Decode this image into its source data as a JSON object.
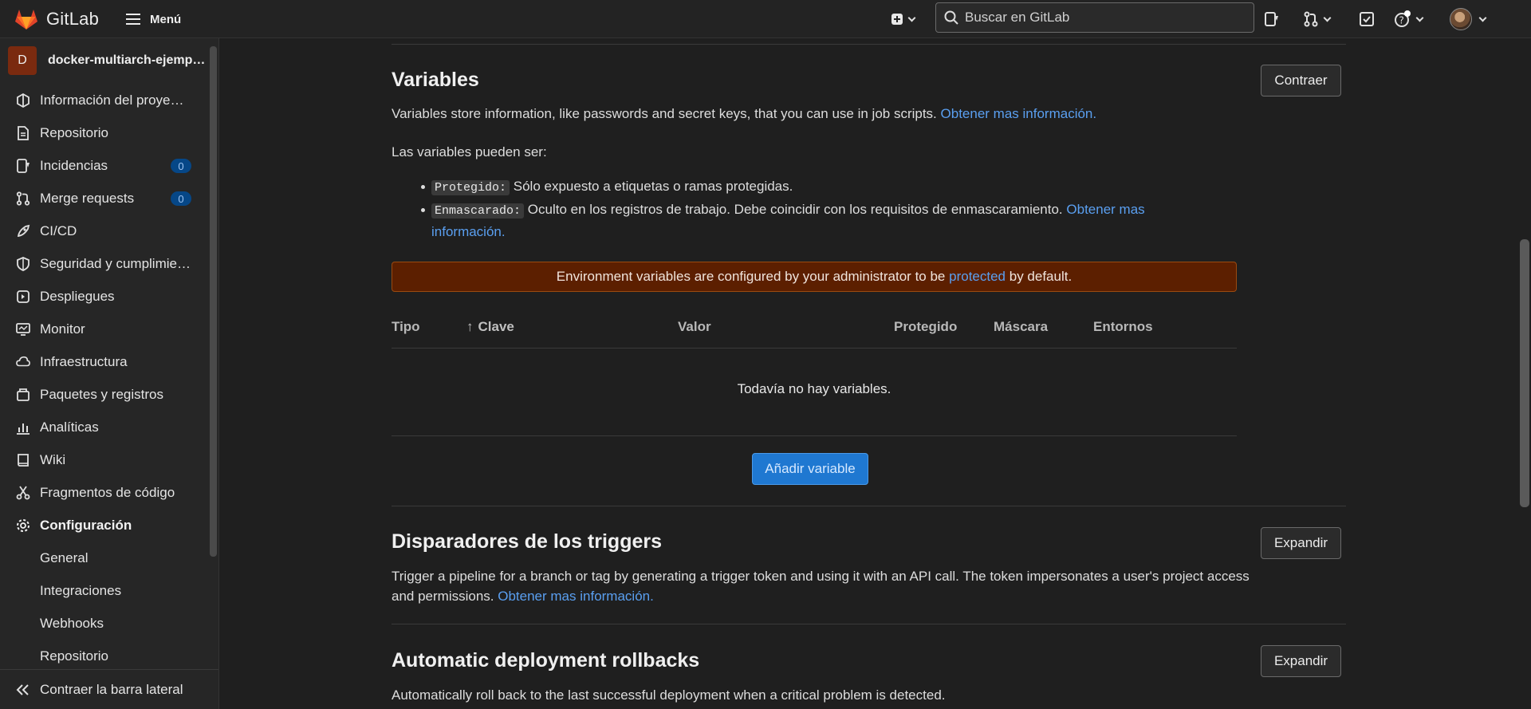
{
  "topbar": {
    "brand": "GitLab",
    "menu_label": "Menú",
    "search_placeholder": "Buscar en GitLab"
  },
  "sidebar": {
    "project_initial": "D",
    "project_name": "docker-multiarch-ejemp…",
    "items": [
      {
        "label": "Información del proye…",
        "icon": "project-info-icon"
      },
      {
        "label": "Repositorio",
        "icon": "document-icon"
      },
      {
        "label": "Incidencias",
        "icon": "issues-icon",
        "badge": "0"
      },
      {
        "label": "Merge requests",
        "icon": "merge-request-icon",
        "badge": "0"
      },
      {
        "label": "CI/CD",
        "icon": "rocket-icon"
      },
      {
        "label": "Seguridad y cumplimie…",
        "icon": "shield-icon"
      },
      {
        "label": "Despliegues",
        "icon": "deployments-icon"
      },
      {
        "label": "Monitor",
        "icon": "monitor-icon"
      },
      {
        "label": "Infraestructura",
        "icon": "cloud-icon"
      },
      {
        "label": "Paquetes y registros",
        "icon": "package-icon"
      },
      {
        "label": "Analíticas",
        "icon": "chart-icon"
      },
      {
        "label": "Wiki",
        "icon": "book-icon"
      },
      {
        "label": "Fragmentos de código",
        "icon": "scissors-icon"
      },
      {
        "label": "Configuración",
        "icon": "gear-icon"
      }
    ],
    "subitems": [
      "General",
      "Integraciones",
      "Webhooks",
      "Repositorio"
    ],
    "collapse_label": "Contraer la barra lateral"
  },
  "variables": {
    "title": "Variables",
    "collapse_button": "Contraer",
    "description": "Variables store information, like passwords and secret keys, that you can use in job scripts.",
    "learn_more": "Obtener mas información.",
    "types_intro": "Las variables pueden ser:",
    "protected_code": "Protegido:",
    "protected_text": "Sólo expuesto a etiquetas o ramas protegidas.",
    "masked_code": "Enmascarado:",
    "masked_text": "Oculto en los registros de trabajo. Debe coincidir con los requisitos de enmascaramiento.",
    "masked_link": "Obtener mas información.",
    "alert_prefix": "Environment variables are configured by your administrator to be",
    "alert_link": "protected",
    "alert_suffix": "by default.",
    "columns": [
      "Tipo",
      "Clave",
      "Valor",
      "Protegido",
      "Máscara",
      "Entornos"
    ],
    "sort_arrow": "↑",
    "empty_text": "Todavía no hay variables.",
    "add_button": "Añadir variable"
  },
  "triggers": {
    "title": "Disparadores de los triggers",
    "expand_button": "Expandir",
    "description": "Trigger a pipeline for a branch or tag by generating a trigger token and using it with an API call. The token impersonates a user's project access and permissions.",
    "learn_more": "Obtener mas información."
  },
  "rollbacks": {
    "title": "Automatic deployment rollbacks",
    "expand_button": "Expandir",
    "description": "Automatically roll back to the last successful deployment when a critical problem is detected."
  }
}
